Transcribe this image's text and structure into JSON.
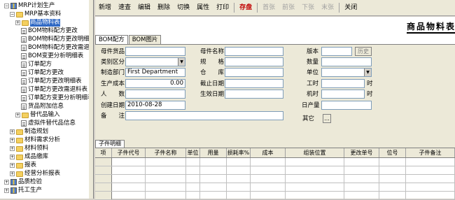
{
  "tree": {
    "items": [
      {
        "label": "MRP计划生产",
        "level": 0,
        "exp": "−",
        "icon": "module"
      },
      {
        "label": "MRP基本资料",
        "level": 1,
        "exp": "−",
        "icon": "folder"
      },
      {
        "label": "商品物料表",
        "level": 2,
        "exp": "+",
        "icon": "folder",
        "selected": true
      },
      {
        "label": "BOM物料配方更改",
        "level": 3,
        "exp": "",
        "icon": "doc"
      },
      {
        "label": "BOM物料配方更改明细",
        "level": 3,
        "exp": "",
        "icon": "doc"
      },
      {
        "label": "BOM物料配方更改需退料",
        "level": 3,
        "exp": "",
        "icon": "doc"
      },
      {
        "label": "BOM变更分析明细表",
        "level": 3,
        "exp": "",
        "icon": "doc"
      },
      {
        "label": "订单配方",
        "level": 3,
        "exp": "",
        "icon": "doc"
      },
      {
        "label": "订单配方更改",
        "level": 3,
        "exp": "",
        "icon": "doc"
      },
      {
        "label": "订单配方更改明细表",
        "level": 3,
        "exp": "",
        "icon": "doc"
      },
      {
        "label": "订单配方更改需退料表",
        "level": 3,
        "exp": "",
        "icon": "doc"
      },
      {
        "label": "订单配方变更分析明细表",
        "level": 3,
        "exp": "",
        "icon": "doc"
      },
      {
        "label": "货品附加信息",
        "level": 3,
        "exp": "",
        "icon": "doc"
      },
      {
        "label": "替代品输入",
        "level": 2,
        "exp": "+",
        "icon": "folder"
      },
      {
        "label": "虚拟件替代品信息",
        "level": 3,
        "exp": "",
        "icon": "doc"
      },
      {
        "label": "制造规划",
        "level": 1,
        "exp": "+",
        "icon": "folder"
      },
      {
        "label": "材料需求分析",
        "level": 1,
        "exp": "+",
        "icon": "folder"
      },
      {
        "label": "材料领料",
        "level": 1,
        "exp": "+",
        "icon": "folder"
      },
      {
        "label": "成品缴库",
        "level": 1,
        "exp": "+",
        "icon": "folder"
      },
      {
        "label": "报表",
        "level": 1,
        "exp": "+",
        "icon": "folder"
      },
      {
        "label": "经营分析报表",
        "level": 1,
        "exp": "+",
        "icon": "folder"
      },
      {
        "label": "品质检验",
        "level": 0,
        "exp": "+",
        "icon": "module"
      },
      {
        "label": "托工生产",
        "level": 0,
        "exp": "+",
        "icon": "module"
      }
    ]
  },
  "toolbar": {
    "buttons": [
      {
        "label": "新增",
        "state": "normal"
      },
      {
        "label": "速查",
        "state": "normal"
      },
      {
        "label": "编辑",
        "state": "normal"
      },
      {
        "label": "删除",
        "state": "normal"
      },
      {
        "label": "切换",
        "state": "normal"
      },
      {
        "label": "属性",
        "state": "normal"
      },
      {
        "label": "打印",
        "state": "normal"
      },
      {
        "label": "存盘",
        "state": "highlight"
      },
      {
        "label": "首张",
        "state": "disabled"
      },
      {
        "label": "前张",
        "state": "disabled"
      },
      {
        "label": "下张",
        "state": "disabled"
      },
      {
        "label": "末张",
        "state": "disabled"
      },
      {
        "label": "关闭",
        "state": "normal"
      }
    ]
  },
  "page": {
    "title": "商品物料表",
    "tabs": [
      "BOM配方",
      "BOM图片"
    ]
  },
  "form": {
    "parent_item_label": "母件货品",
    "category_label": "类别区分",
    "dept_label": "制造部门",
    "dept_value": "First Department",
    "cost_label": "生产成本",
    "cost_value": "0.00",
    "headcount_label": "人　　数",
    "created_label": "创建日期",
    "created_value": "2010-08-28",
    "remark_label": "备　　注",
    "parent_name_label": "母件名称",
    "spec_label": "规　　格",
    "warehouse_label": "仓　　库",
    "expire_label": "截止日期",
    "effective_label": "生效日期",
    "version_label": "版本",
    "history_button": "历史",
    "qty_label": "数量",
    "unit_label": "单位",
    "worktime_label": "工时",
    "worktime_unit": "时",
    "machine_label": "机时",
    "machine_unit": "时",
    "daily_output_label": "日产量",
    "other_label": "其它",
    "other_button": "..."
  },
  "subtable": {
    "tab_label": "子件明细",
    "columns": [
      "项",
      "子件代号",
      "子件名称",
      "单位",
      "用量",
      "损耗率%",
      "成本",
      "组装位置",
      "更改单号",
      "位号",
      "子件备注"
    ]
  },
  "colors": {
    "selected": "#316ac5",
    "save_highlight": "#c00000",
    "panel": "#ece9d8"
  }
}
